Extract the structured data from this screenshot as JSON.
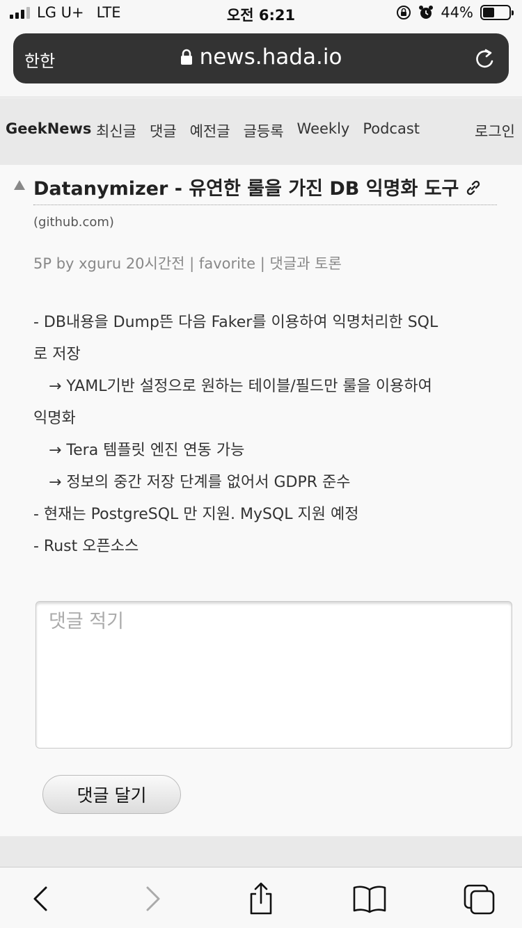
{
  "status_bar": {
    "carrier": "LG U+",
    "network": "LTE",
    "time": "오전 6:21",
    "battery_text": "44%",
    "battery_level": 0.44
  },
  "browser": {
    "reader_label": "한한",
    "host": "news.hada.io"
  },
  "site_nav": {
    "brand": "GeekNews",
    "links": [
      "최신글",
      "댓글",
      "예전글",
      "글등록",
      "Weekly",
      "Podcast"
    ],
    "login": "로그인"
  },
  "post": {
    "title": "Datanymizer - 유연한 룰을 가진 DB 익명화 도구",
    "domain": "(github.com)",
    "meta": "5P by xguru 20시간전 | favorite | 댓글과 토론",
    "lines": [
      "- DB내용을 Dump뜬 다음 Faker를 이용하여 익명처리한 SQL",
      "로 저장",
      "→ YAML기반 설정으로 원하는 테이블/필드만 룰을 이용하여",
      "익명화",
      "→ Tera 템플릿 엔진 연동 가능",
      "→ 정보의 중간 저장 단계를 없어서 GDPR 준수",
      "- 현재는 PostgreSQL 만 지원. MySQL 지원 예정",
      "- Rust 오픈소스"
    ]
  },
  "comment": {
    "placeholder": "댓글 적기",
    "submit_label": "댓글 달기"
  },
  "colors": {
    "url_bar_bg": "#333333",
    "nav_bg": "#e9e9e9",
    "meta_text": "#888888"
  },
  "icons": {
    "toolbar": [
      "back-icon",
      "forward-icon",
      "share-icon",
      "bookmarks-icon",
      "tabs-icon"
    ]
  }
}
